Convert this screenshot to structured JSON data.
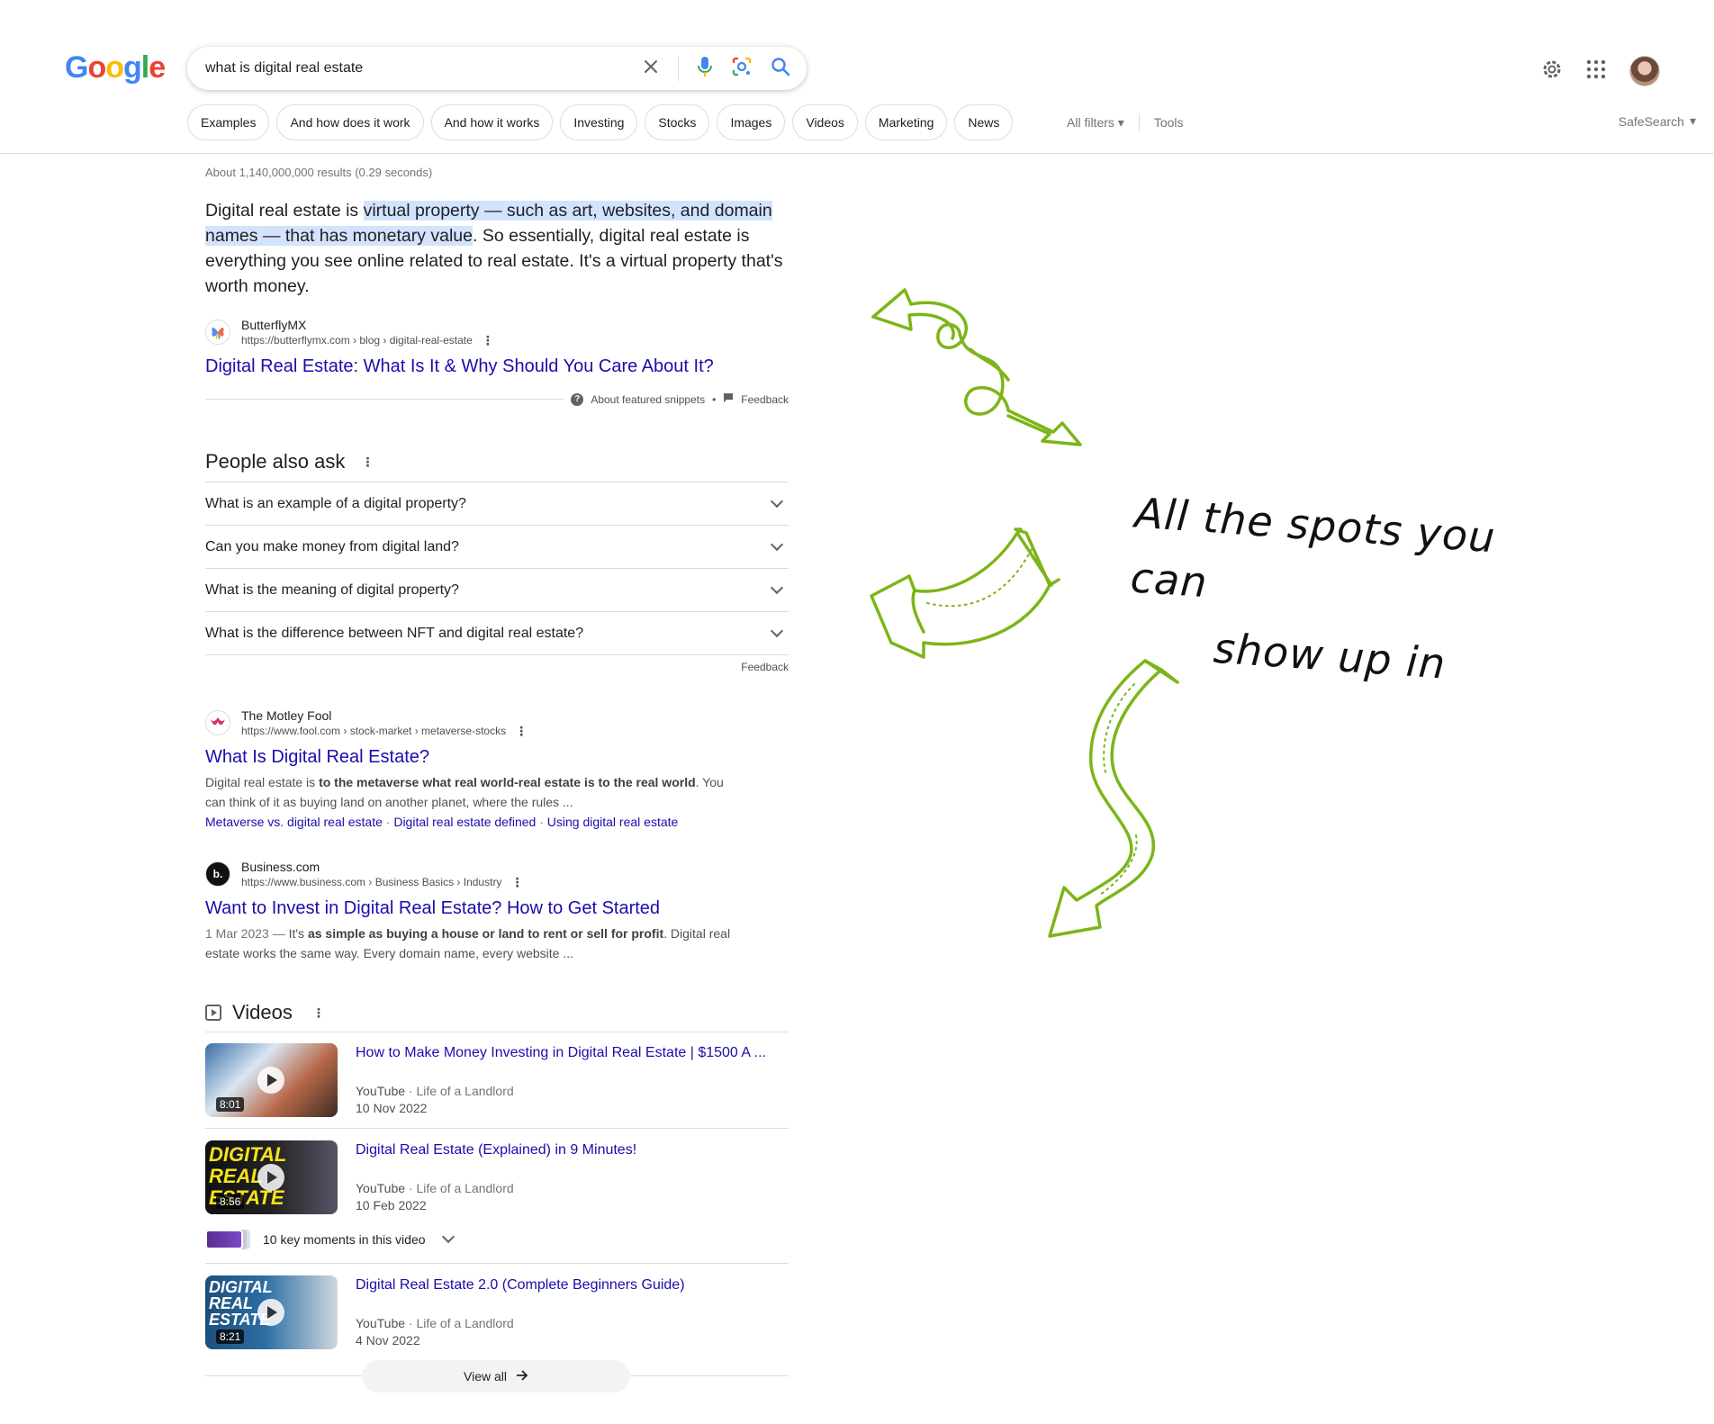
{
  "header": {
    "logo_letters": [
      {
        "ch": "G",
        "color": "#4285F4"
      },
      {
        "ch": "o",
        "color": "#EA4335"
      },
      {
        "ch": "o",
        "color": "#FBBC05"
      },
      {
        "ch": "g",
        "color": "#4285F4"
      },
      {
        "ch": "l",
        "color": "#34A853"
      },
      {
        "ch": "e",
        "color": "#EA4335"
      }
    ],
    "search_query": "what is digital real estate",
    "icons": [
      "clear-icon",
      "mic-icon",
      "lens-icon",
      "search-icon",
      "settings-icon",
      "apps-icon",
      "avatar"
    ]
  },
  "chips": [
    "Examples",
    "And how does it work",
    "And how it works",
    "Investing",
    "Stocks",
    "Images",
    "Videos",
    "Marketing",
    "News"
  ],
  "filters": {
    "all_filters": "All filters",
    "tools": "Tools",
    "safesearch": "SafeSearch"
  },
  "stats": "About 1,140,000,000 results (0.29 seconds)",
  "featured_snippet": {
    "text_before": "Digital real estate is ",
    "text_highlight": "virtual property — such as art, websites, and domain names — that has monetary value",
    "text_after": ". So essentially, digital real estate is everything you see online related to real estate. It's a virtual property that's worth money.",
    "source_name": "ButterflyMX",
    "source_url": "https://butterflymx.com › blog › digital-real-estate",
    "title": "Digital Real Estate: What Is It & Why Should You Care About It?",
    "about_label": "About featured snippets",
    "feedback_label": "Feedback"
  },
  "people_also_ask": {
    "title": "People also ask",
    "questions": [
      "What is an example of a digital property?",
      "Can you make money from digital land?",
      "What is the meaning of digital property?",
      "What is the difference between NFT and digital real estate?"
    ],
    "feedback_label": "Feedback"
  },
  "results": [
    {
      "source_name": "The Motley Fool",
      "url": "https://www.fool.com › stock-market › metaverse-stocks",
      "title": "What Is Digital Real Estate?",
      "desc_plain_1": "Digital real estate is ",
      "desc_bold_1": "to the metaverse what real world-real estate is to the real world",
      "desc_plain_2": ". You can think of it as buying land on another planet, where the rules ...",
      "sublinks": [
        "Metaverse vs. digital real estate",
        "Digital real estate defined",
        "Using digital real estate"
      ]
    },
    {
      "source_name": "Business.com",
      "url": "https://www.business.com › Business Basics › Industry",
      "title": "Want to Invest in Digital Real Estate? How to Get Started",
      "date": "1 Mar 2023 — ",
      "desc_plain_1": "It's ",
      "desc_bold_1": "as simple as buying a house or land to rent or sell for profit",
      "desc_plain_2": ". Digital real estate works the same way. Every domain name, every website ..."
    }
  ],
  "videos": {
    "title": "Videos",
    "items": [
      {
        "title": "How to Make Money Investing in Digital Real Estate | $1500 A ...",
        "platform": "YouTube",
        "channel": " · Life of a Landlord",
        "date": "10 Nov 2022",
        "duration": "8:01"
      },
      {
        "title": "Digital Real Estate (Explained) in 9 Minutes!",
        "platform": "YouTube",
        "channel": " · Life of a Landlord",
        "date": "10 Feb 2022",
        "duration": "8:56",
        "thumb_text": "DIGITAL REAL ESTATE",
        "key_moments": "10 key moments in this video"
      },
      {
        "title": "Digital Real Estate 2.0 (Complete Beginners Guide)",
        "platform": "YouTube",
        "channel": " · Life of a Landlord",
        "date": "4 Nov 2022",
        "duration": "8:21",
        "thumb_text": "DIGITAL REAL ESTATE"
      }
    ],
    "view_all": "View all"
  },
  "annotation": {
    "line1": "All the spots you can",
    "line2": "show up in",
    "arrow_color": "#7cb518"
  }
}
